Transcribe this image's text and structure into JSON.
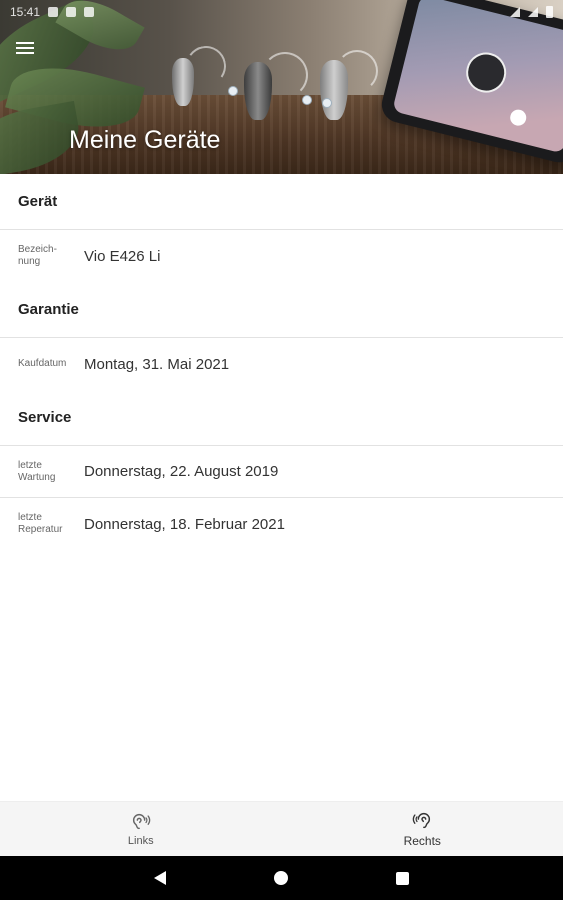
{
  "status_bar": {
    "time": "15:41"
  },
  "header": {
    "title": "Meine Geräte"
  },
  "sections": [
    {
      "title": "Gerät",
      "rows": [
        {
          "label": "Bezeich-\nnung",
          "value": "Vio E426 Li"
        }
      ]
    },
    {
      "title": "Garantie",
      "rows": [
        {
          "label": "Kaufdatum",
          "value": "Montag, 31. Mai 2021"
        }
      ]
    },
    {
      "title": "Service",
      "rows": [
        {
          "label": "letzte\nWartung",
          "value": "Donnerstag, 22. August 2019"
        },
        {
          "label": "letzte\nReperatur",
          "value": "Donnerstag, 18. Februar 2021"
        }
      ]
    }
  ],
  "bottom_nav": {
    "items": [
      {
        "label": "Links",
        "icon": "ear-waves-icon"
      },
      {
        "label": "Rechts",
        "icon": "ear-waves-icon"
      }
    ]
  },
  "colors": {
    "accent": "#222222",
    "nav_bg": "#f5f5f5",
    "divider": "#e2e2e2"
  }
}
